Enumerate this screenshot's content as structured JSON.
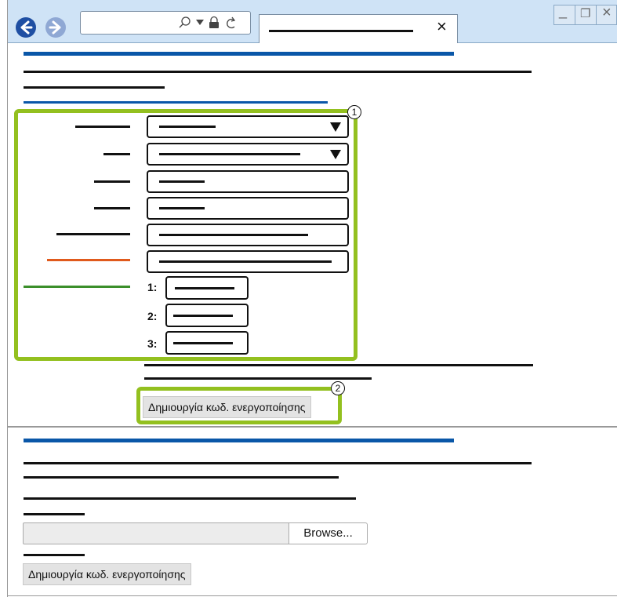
{
  "browser": {
    "back_icon": "arrow-left-icon",
    "forward_icon": "arrow-right-icon",
    "search_icon": "search-icon",
    "dropdown_icon": "chevron-down-icon",
    "lock_icon": "lock-icon",
    "refresh_icon": "refresh-icon",
    "tab_close": "×",
    "window_minimize": "_",
    "window_restore": "❐",
    "window_close": "×"
  },
  "form": {
    "rows": [
      {
        "type": "select"
      },
      {
        "type": "select"
      },
      {
        "type": "text"
      },
      {
        "type": "text"
      },
      {
        "type": "text"
      },
      {
        "type": "text",
        "label_color": "#e05a1c"
      },
      {
        "type": "multi",
        "label_color": "#3b8f2a"
      }
    ],
    "sub_labels": [
      "1:",
      "2:",
      "3:"
    ],
    "callout_1": "1",
    "callout_2": "2",
    "generate_button": "Δημιουργία κωδ. ενεργοποίησης"
  },
  "lower": {
    "browse_button": "Browse...",
    "file_input_value": "",
    "generate_button": "Δημιουργία κωδ. ενεργοποίησης"
  },
  "colors": {
    "accent_blue": "#0a57a8",
    "highlight_green": "#93c01f",
    "orange": "#e05a1c",
    "green": "#3b8f2a"
  }
}
